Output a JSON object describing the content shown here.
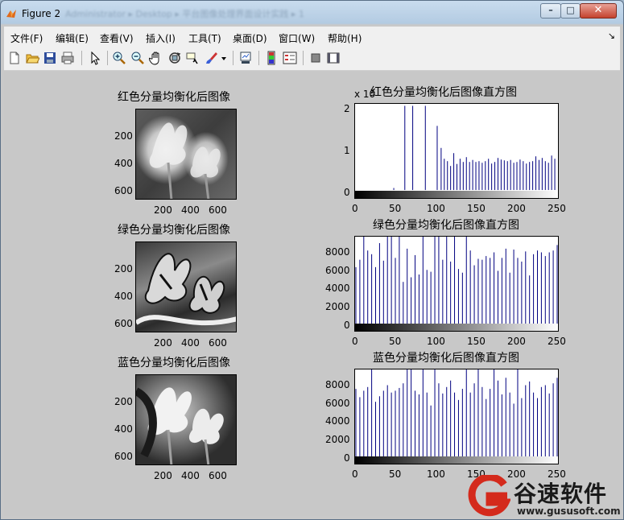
{
  "window": {
    "title": "Figure 2",
    "blurred_path": "Administrator ▸ Desktop ▸ 平台图像处理界面设计实践 ▸ 1",
    "minimize": "–",
    "maximize": "□",
    "close": "✕"
  },
  "menu": [
    "文件(F)",
    "编辑(E)",
    "查看(V)",
    "插入(I)",
    "工具(T)",
    "桌面(D)",
    "窗口(W)",
    "帮助(H)"
  ],
  "menu_overflow": "↘",
  "toolbar_icons": [
    "new-figure-icon",
    "open-file-icon",
    "save-icon",
    "print-icon",
    "pointer-icon",
    "zoom-in-icon",
    "zoom-out-icon",
    "pan-hand-icon",
    "rotate-3d-icon",
    "data-cursor-icon",
    "brush-icon",
    "brush-dropdown-icon",
    "link-plot-icon",
    "insert-colorbar-icon",
    "insert-legend-icon",
    "hide-plot-tools-icon",
    "show-plot-tools-icon"
  ],
  "panels": [
    {
      "image_title": "红色分量均衡化后图像",
      "image_yticks": [
        "200",
        "400",
        "600"
      ],
      "image_xticks": [
        "200",
        "400",
        "600"
      ],
      "hist_title": "红色分量均衡化后图像直方图",
      "hist_exponent": "x 10",
      "hist_yticks": [
        "2",
        "1",
        "0"
      ],
      "hist_xticks": [
        "0",
        "50",
        "100",
        "150",
        "200",
        "250"
      ]
    },
    {
      "image_title": "绿色分量均衡化后图像",
      "image_yticks": [
        "200",
        "400",
        "600"
      ],
      "image_xticks": [
        "200",
        "400",
        "600"
      ],
      "hist_title": "绿色分量均衡化后图像直方图",
      "hist_exponent": "",
      "hist_yticks": [
        "8000",
        "6000",
        "4000",
        "2000",
        "0"
      ],
      "hist_xticks": [
        "0",
        "50",
        "100",
        "150",
        "200",
        "250"
      ]
    },
    {
      "image_title": "蓝色分量均衡化后图像",
      "image_yticks": [
        "200",
        "400",
        "600"
      ],
      "image_xticks": [
        "200",
        "400",
        "600"
      ],
      "hist_title": "蓝色分量均衡化后图像直方图",
      "hist_exponent": "",
      "hist_yticks": [
        "8000",
        "6000",
        "4000",
        "2000",
        "0"
      ],
      "hist_xticks": [
        "0",
        "50",
        "100",
        "150",
        "200",
        "250"
      ]
    }
  ],
  "chart_data": [
    {
      "type": "bar",
      "title": "红色分量均衡化后图像直方图",
      "xlim": [
        0,
        255
      ],
      "ylim": [
        -0.2,
        2.15
      ],
      "y_exponent_label": "x 10",
      "x": [
        48,
        62,
        72,
        88,
        103,
        108,
        112,
        116,
        120,
        124,
        128,
        132,
        136,
        140,
        144,
        148,
        152,
        156,
        160,
        164,
        168,
        172,
        176,
        180,
        184,
        188,
        192,
        196,
        200,
        204,
        208,
        212,
        216,
        220,
        224,
        228,
        232,
        236,
        240,
        244,
        248,
        252
      ],
      "y": [
        0.05,
        2.1,
        2.1,
        2.1,
        1.6,
        1.05,
        0.78,
        0.72,
        0.6,
        0.92,
        0.65,
        0.78,
        0.7,
        0.82,
        0.7,
        0.75,
        0.7,
        0.72,
        0.68,
        0.72,
        0.78,
        0.66,
        0.7,
        0.8,
        0.76,
        0.74,
        0.72,
        0.75,
        0.68,
        0.7,
        0.76,
        0.72,
        0.66,
        0.7,
        0.72,
        0.84,
        0.75,
        0.8,
        0.72,
        0.68,
        0.86,
        0.78
      ],
      "bar_color": "#000080"
    },
    {
      "type": "bar",
      "title": "绿色分量均衡化后图像直方图",
      "xlim": [
        0,
        255
      ],
      "ylim": [
        -700,
        9500
      ],
      "x": [
        0,
        5,
        10,
        15,
        20,
        25,
        30,
        35,
        40,
        45,
        50,
        55,
        60,
        65,
        70,
        75,
        80,
        85,
        90,
        95,
        100,
        105,
        110,
        115,
        120,
        125,
        130,
        135,
        140,
        145,
        150,
        155,
        160,
        165,
        170,
        175,
        180,
        185,
        190,
        195,
        200,
        205,
        210,
        215,
        220,
        225,
        230,
        235,
        240,
        245,
        250,
        255
      ],
      "y": [
        6200,
        7000,
        9500,
        8000,
        7600,
        6200,
        8800,
        6900,
        9500,
        9500,
        7200,
        9500,
        4600,
        8200,
        5100,
        7500,
        5400,
        9500,
        5900,
        5700,
        9500,
        9500,
        7000,
        9500,
        6800,
        9500,
        6000,
        5600,
        9500,
        8000,
        6400,
        7100,
        7000,
        7400,
        7200,
        7800,
        5800,
        7200,
        8200,
        5600,
        8100,
        7200,
        6800,
        7900,
        5300,
        7600,
        8000,
        7800,
        7400,
        7800,
        8000,
        8600
      ],
      "bar_color": "#000080"
    },
    {
      "type": "bar",
      "title": "蓝色分量均衡化后图像直方图",
      "xlim": [
        0,
        255
      ],
      "ylim": [
        -700,
        9500
      ],
      "x": [
        0,
        5,
        10,
        15,
        20,
        25,
        30,
        35,
        40,
        45,
        50,
        55,
        60,
        65,
        70,
        75,
        80,
        85,
        90,
        95,
        100,
        105,
        110,
        115,
        120,
        125,
        130,
        135,
        140,
        145,
        150,
        155,
        160,
        165,
        170,
        175,
        180,
        185,
        190,
        195,
        200,
        205,
        210,
        215,
        220,
        225,
        230,
        235,
        240,
        245,
        250,
        255
      ],
      "y": [
        7400,
        6500,
        7200,
        7600,
        9500,
        6000,
        6600,
        7200,
        7800,
        7000,
        7200,
        7500,
        8000,
        9500,
        9500,
        7200,
        6800,
        9500,
        7000,
        5600,
        9500,
        8000,
        6900,
        7600,
        8300,
        7000,
        6200,
        7400,
        9500,
        7000,
        8000,
        9500,
        7600,
        6300,
        7400,
        9500,
        8300,
        6800,
        8600,
        7000,
        5800,
        9500,
        6400,
        7800,
        8200,
        7000,
        6400,
        7600,
        7800,
        6900,
        8000,
        8600
      ],
      "bar_color": "#000080"
    }
  ],
  "watermark": {
    "logo_letter": "G",
    "brand": "谷速软件",
    "url": "www.gususoft.com",
    "brand_color": "#d42a1c"
  }
}
